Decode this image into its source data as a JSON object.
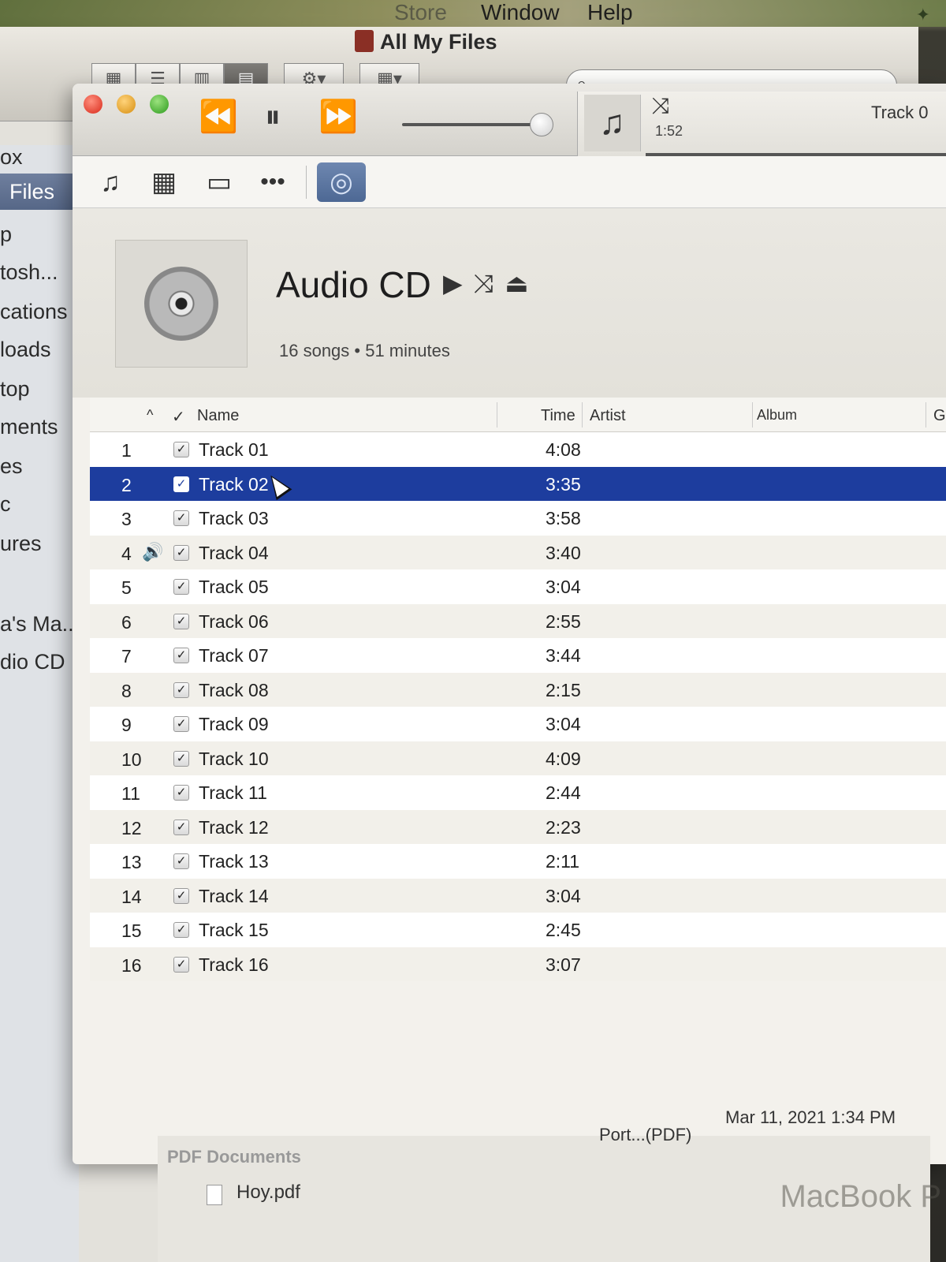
{
  "menubar": {
    "store": "Store",
    "window": "Window",
    "help": "Help"
  },
  "finder": {
    "title": "All My Files",
    "sidebar": [
      {
        "label": "ox"
      },
      {
        "label": "Files",
        "selected": true
      },
      {
        "label": "p"
      },
      {
        "label": "tosh..."
      },
      {
        "label": "cations"
      },
      {
        "label": "loads"
      },
      {
        "label": "top"
      },
      {
        "label": "ments"
      },
      {
        "label": "es"
      },
      {
        "label": "c"
      },
      {
        "label": "ures"
      },
      {
        "label": "a's Ma..."
      },
      {
        "label": "dio CD ⏏"
      }
    ],
    "group_header": "PDF Documents",
    "file_name": "Hoy.pdf",
    "file_kind": "Port...(PDF)",
    "file_date": "Mar 11, 2021 1:34 PM"
  },
  "itunes": {
    "now_playing": {
      "track": "Track 0",
      "elapsed": "1:52"
    },
    "volume_level": 0.95,
    "sources": [
      "music-icon",
      "movies-icon",
      "tv-icon",
      "more-icon",
      "cd-icon"
    ],
    "cd": {
      "title": "Audio CD",
      "summary": "16 songs • 51 minutes"
    },
    "columns": {
      "sort": "^",
      "check": "✓",
      "name": "Name",
      "time": "Time",
      "artist": "Artist",
      "album": "Album",
      "genre": "G"
    },
    "tracks": [
      {
        "num": "1",
        "name": "Track 01",
        "time": "4:08"
      },
      {
        "num": "2",
        "name": "Track 02",
        "time": "3:35",
        "selected": true
      },
      {
        "num": "3",
        "name": "Track 03",
        "time": "3:58"
      },
      {
        "num": "4",
        "name": "Track 04",
        "time": "3:40",
        "playing": true
      },
      {
        "num": "5",
        "name": "Track 05",
        "time": "3:04"
      },
      {
        "num": "6",
        "name": "Track 06",
        "time": "2:55"
      },
      {
        "num": "7",
        "name": "Track 07",
        "time": "3:44"
      },
      {
        "num": "8",
        "name": "Track 08",
        "time": "2:15"
      },
      {
        "num": "9",
        "name": "Track 09",
        "time": "3:04"
      },
      {
        "num": "10",
        "name": "Track 10",
        "time": "4:09"
      },
      {
        "num": "11",
        "name": "Track 11",
        "time": "2:44"
      },
      {
        "num": "12",
        "name": "Track 12",
        "time": "2:23"
      },
      {
        "num": "13",
        "name": "Track 13",
        "time": "2:11"
      },
      {
        "num": "14",
        "name": "Track 14",
        "time": "3:04"
      },
      {
        "num": "15",
        "name": "Track 15",
        "time": "2:45"
      },
      {
        "num": "16",
        "name": "Track 16",
        "time": "3:07"
      }
    ],
    "selection_color": "#1d3d9e"
  },
  "watermark": "MacBook P"
}
